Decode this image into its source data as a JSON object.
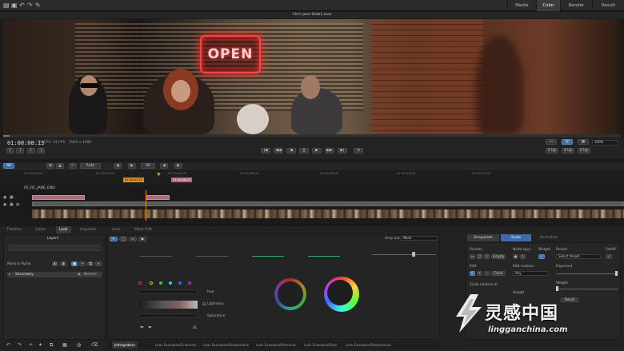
{
  "header": {
    "tabs": [
      {
        "label": "Media",
        "active": false
      },
      {
        "label": "Color",
        "active": true
      },
      {
        "label": "Render",
        "active": false
      },
      {
        "label": "Result",
        "active": false
      }
    ],
    "file_title": "Chris Jane Slide1.mov"
  },
  "viewer": {
    "sign_text": "OPEN"
  },
  "transport": {
    "timecode": "01:00:08:13",
    "fps": "24 FPS",
    "fps2": "24 FPS",
    "resolution": "1920 x 1080",
    "zoom": "100%",
    "view_2up": "2 Up",
    "view_4up": "4 Up",
    "view_2": "2 Up"
  },
  "timeline": {
    "auto_label": "Auto",
    "all_label": "All",
    "tc_in": "01:00:07:13",
    "tc_out": "01:00:08:23",
    "seq_name": "05_RE_JANE_END",
    "ruler_ticks": [
      "01:00:00:00",
      "01:00:02:00",
      "01:00:04:00",
      "01:00:06:00",
      "01:00:08:00",
      "01:00:10:00",
      "01:00:12:00"
    ],
    "playhead_tc": "01:00:08:13"
  },
  "panels": {
    "left_tabs": [
      "Timeline",
      "Looks",
      "Look",
      "Inspector",
      "Auto",
      "Mask Edit"
    ],
    "layers_title": "Layers",
    "mask_alpha": "Mask & Alpha",
    "layer_name": "Secondary",
    "layer_mode": "Normal",
    "center": {
      "grey_out_label": "Grey out",
      "grey_out_value": "None",
      "hue": "Hue",
      "lightness": "Lightness",
      "saturation": "Saturation"
    },
    "right_tabs": [
      "Snapshots",
      "Scale",
      "Animation"
    ],
    "right": {
      "presets": "Presets",
      "node_type": "Node type",
      "widget": "Widget",
      "preset": "Preset",
      "falloff": "Falloff",
      "empty": "Empty",
      "preset_select": "Select Preset...",
      "edit": "Edit",
      "edit_contour": "Edit contour",
      "exponent": "Exponent",
      "clear": "Clear",
      "any": "Any",
      "weight": "Weight",
      "scale_relative": "Scale relative to",
      "height": "Height",
      "reset": "Reset"
    },
    "bottom_tabs": [
      "Jettingmbem",
      "Look Examples/Cinematic",
      "Look Examples/Desaturation",
      "Look Examples/Primaries",
      "Look Examples/Style",
      "Look Examples/Temperature"
    ]
  },
  "watermark": {
    "main": "灵感中国",
    "sub": "lingganchina.com"
  }
}
